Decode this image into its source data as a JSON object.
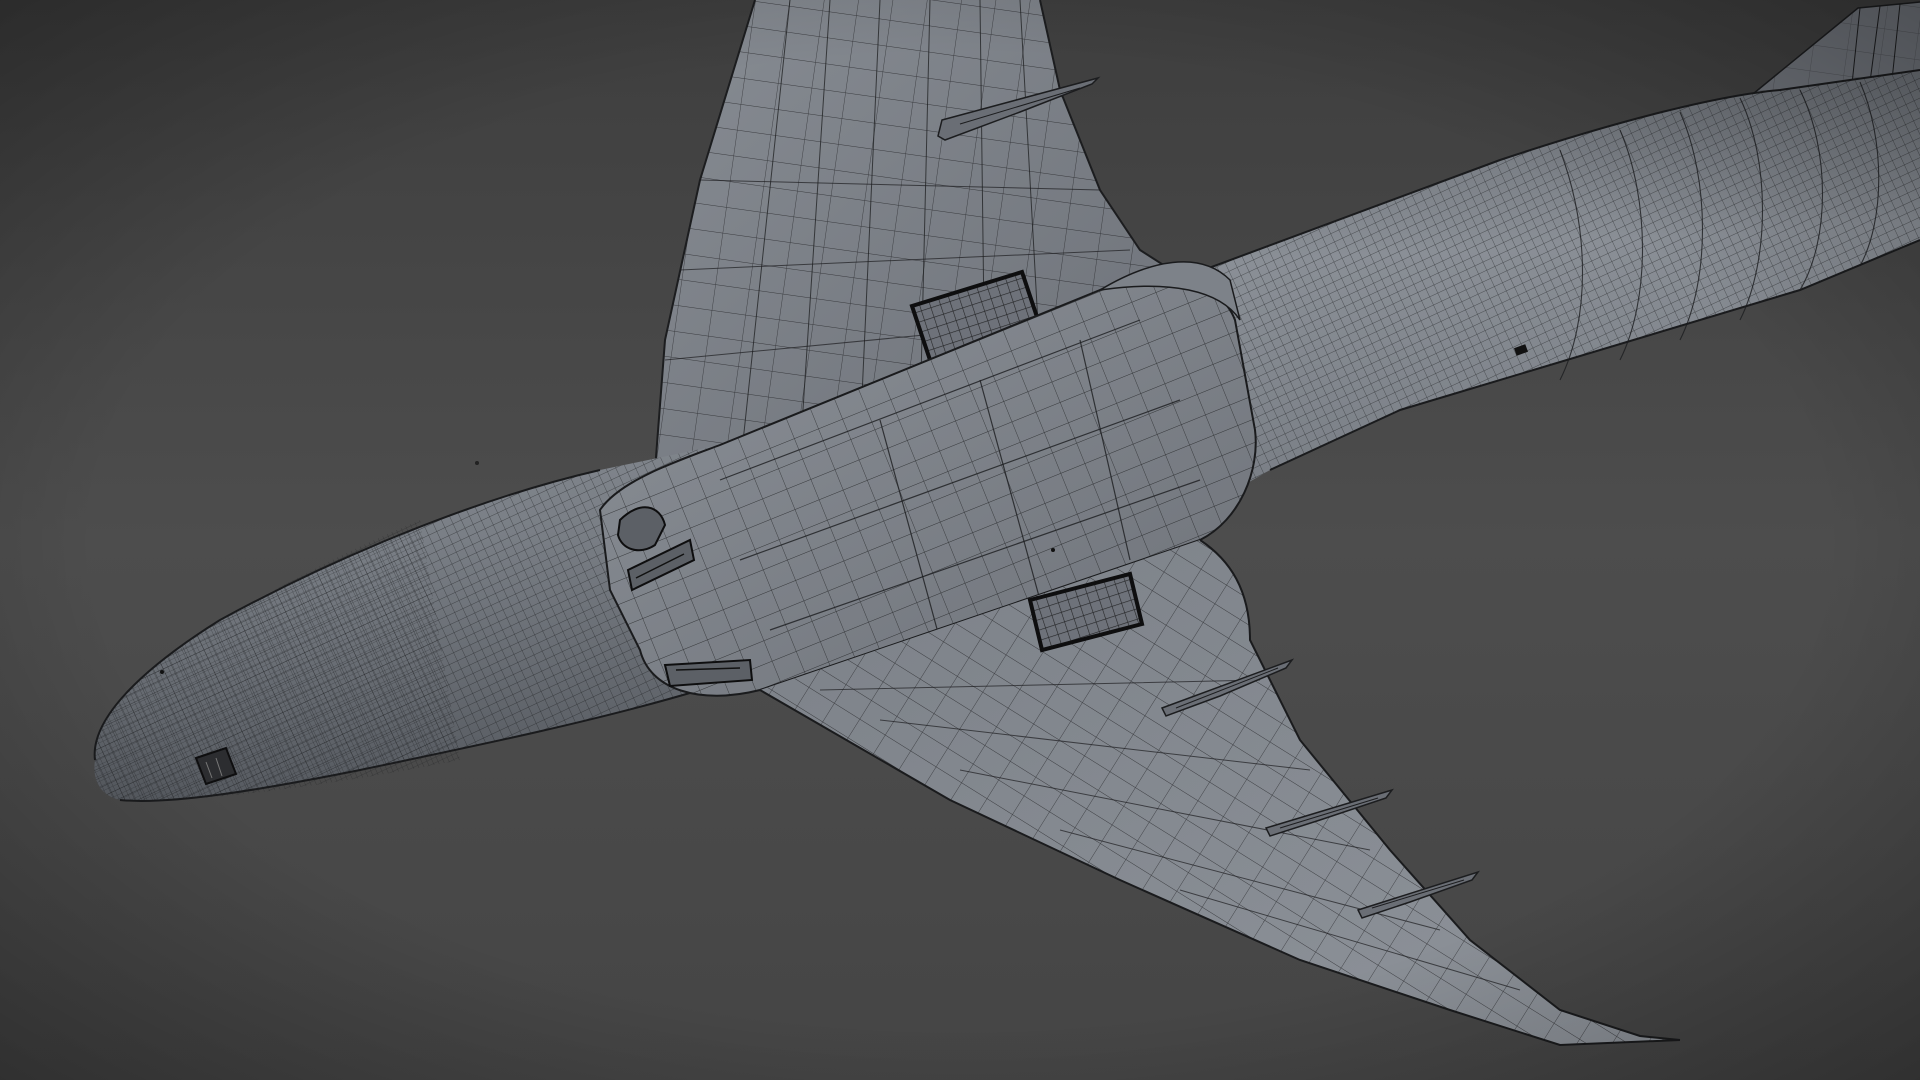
{
  "viewport": {
    "background_color": "#4c4c4c",
    "surface_color": "#7a7f86",
    "surface_shadow_color": "#50545a",
    "wire_color": "#1c1d1f",
    "display_mode": "wireframe-on-shaded",
    "subject": "aircraft-underside"
  }
}
